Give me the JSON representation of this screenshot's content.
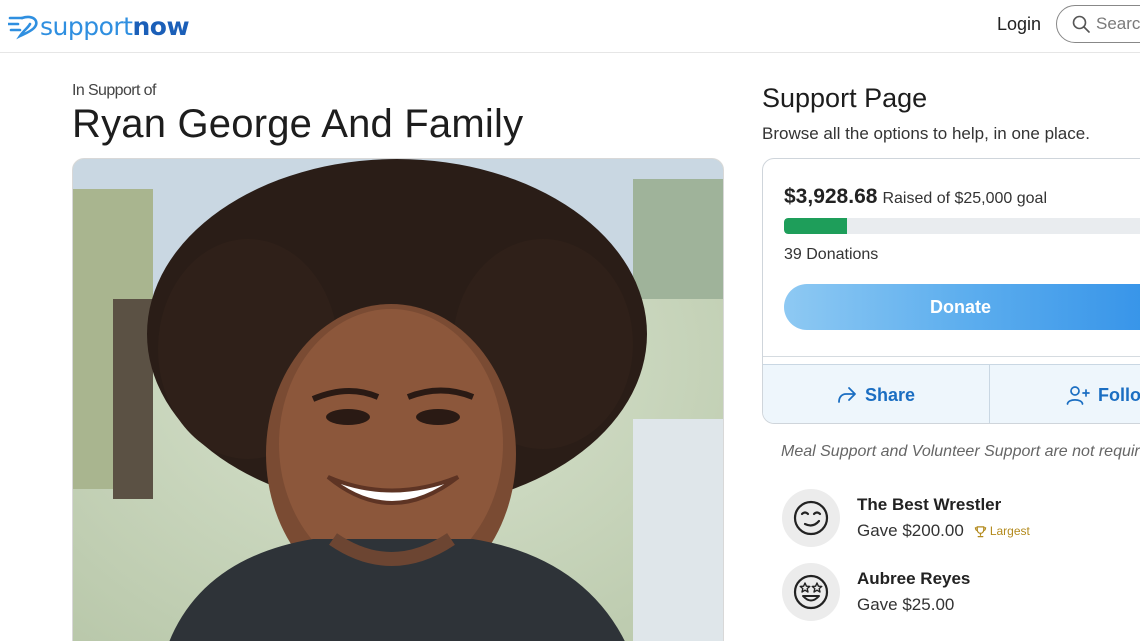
{
  "header": {
    "logo": {
      "part1": "support",
      "part2": "now"
    },
    "login_label": "Login",
    "search_placeholder": "Search"
  },
  "fundraiser": {
    "eyebrow": "In Support of",
    "title": "Ryan George And Family"
  },
  "support_page": {
    "title": "Support Page",
    "subtitle": "Browse all the options to help, in one place.",
    "raised_amount": "$3,928.68",
    "raised_goal_text": "Raised of $25,000 goal",
    "progress_fraction": 0.157,
    "donations_text": "39 Donations",
    "donate_label": "Donate",
    "share_label": "Share",
    "follow_label": "Follow",
    "note": "Meal Support and Volunteer Support are not required"
  },
  "donors": [
    {
      "name": "The Best Wrestler",
      "gift": "Gave $200.00",
      "badge": "Largest",
      "avatar_icon": "smirk-face-icon"
    },
    {
      "name": "Aubree Reyes",
      "gift": "Gave $25.00",
      "badge": "",
      "avatar_icon": "star-eyes-face-icon"
    }
  ],
  "colors": {
    "brand_blue": "#2f8fe0",
    "progress_green": "#1e9e5a",
    "action_blue": "#1b6ec2",
    "largest_gold": "#b38a1d"
  }
}
